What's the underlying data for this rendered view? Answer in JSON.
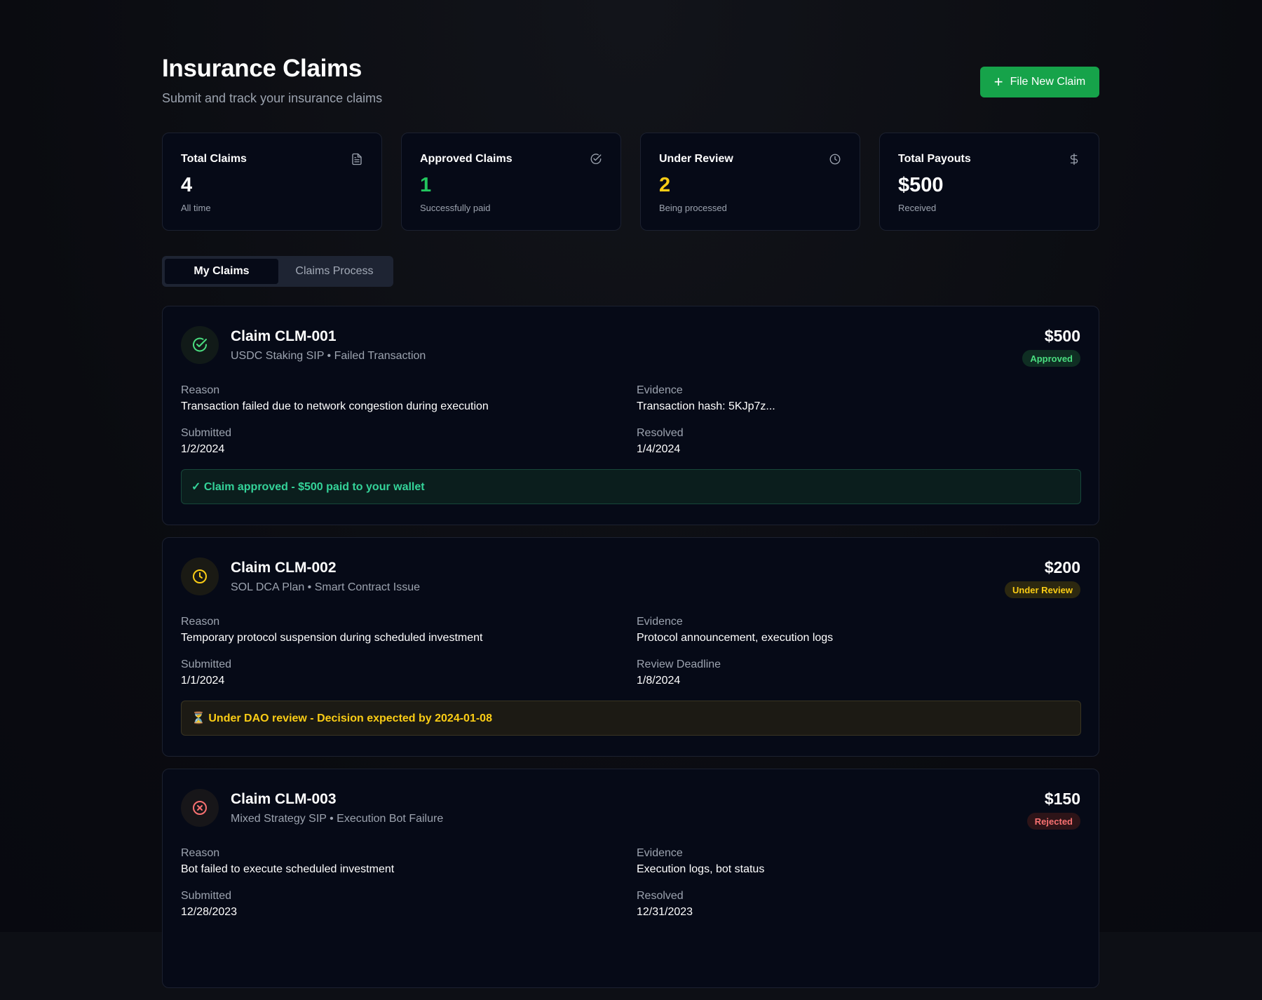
{
  "header": {
    "title": "Insurance Claims",
    "subtitle": "Submit and track your insurance claims",
    "new_claim_label": "File New Claim"
  },
  "stats": [
    {
      "title": "Total Claims",
      "value": "4",
      "sub": "All time",
      "icon": "document-icon",
      "color": "#ffffff"
    },
    {
      "title": "Approved Claims",
      "value": "1",
      "sub": "Successfully paid",
      "icon": "check-circle-icon",
      "color": "#22c55e"
    },
    {
      "title": "Under Review",
      "value": "2",
      "sub": "Being processed",
      "icon": "clock-icon",
      "color": "#facc15"
    },
    {
      "title": "Total Payouts",
      "value": "$500",
      "sub": "Received",
      "icon": "dollar-icon",
      "color": "#ffffff"
    }
  ],
  "tabs": [
    {
      "label": "My Claims",
      "active": true
    },
    {
      "label": "Claims Process",
      "active": false
    }
  ],
  "claims": [
    {
      "title": "Claim CLM-001",
      "meta": "USDC Staking SIP • Failed Transaction",
      "amount": "$500",
      "status": "Approved",
      "status_icon": "check-circle-icon",
      "reason_label": "Reason",
      "reason": "Transaction failed due to network congestion during execution",
      "evidence_label": "Evidence",
      "evidence": "Transaction hash: 5KJp7z...",
      "submitted_label": "Submitted",
      "submitted": "1/2/2024",
      "second_date_label": "Resolved",
      "second_date": "1/4/2024",
      "note": "✓ Claim approved - $500 paid to your wallet"
    },
    {
      "title": "Claim CLM-002",
      "meta": "SOL DCA Plan • Smart Contract Issue",
      "amount": "$200",
      "status": "Under Review",
      "status_icon": "clock-icon",
      "reason_label": "Reason",
      "reason": "Temporary protocol suspension during scheduled investment",
      "evidence_label": "Evidence",
      "evidence": "Protocol announcement, execution logs",
      "submitted_label": "Submitted",
      "submitted": "1/1/2024",
      "second_date_label": "Review Deadline",
      "second_date": "1/8/2024",
      "note": "⏳ Under DAO review - Decision expected by 2024-01-08"
    },
    {
      "title": "Claim CLM-003",
      "meta": "Mixed Strategy SIP • Execution Bot Failure",
      "amount": "$150",
      "status": "Rejected",
      "status_icon": "x-circle-icon",
      "reason_label": "Reason",
      "reason": "Bot failed to execute scheduled investment",
      "evidence_label": "Evidence",
      "evidence": "Execution logs, bot status",
      "submitted_label": "Submitted",
      "submitted": "12/28/2023",
      "second_date_label": "Resolved",
      "second_date": "12/31/2023"
    }
  ],
  "colors": {
    "accent_green": "#16a34a",
    "approved": "#4ade80",
    "review": "#facc15",
    "rejected": "#f87171"
  }
}
